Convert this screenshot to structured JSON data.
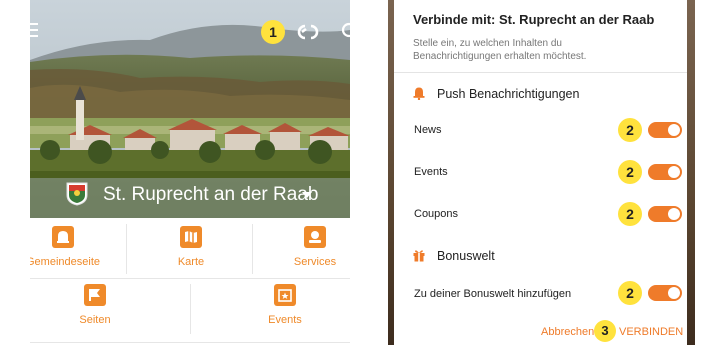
{
  "left_screen": {
    "town_name": "St. Ruprecht an der Raab",
    "annotation_badge": "1",
    "tiles": [
      {
        "label": "Gemeindeseite",
        "icon": "bell-icon"
      },
      {
        "label": "Karte",
        "icon": "map-icon"
      },
      {
        "label": "Services",
        "icon": "services-icon"
      },
      {
        "label": "Seiten",
        "icon": "flag-icon"
      },
      {
        "label": "Events",
        "icon": "calendar-star-icon"
      }
    ],
    "colors": {
      "accent": "#ef8a2a",
      "badge": "#ffe23d"
    }
  },
  "dialog": {
    "title": "Verbinde mit: St. Ruprecht an der Raab",
    "subtitle": "Stelle ein, zu welchen Inhalten du Benachrichtigungen erhalten möchtest.",
    "push_section": {
      "heading": "Push Benachrichtigungen",
      "icon": "bell-icon",
      "items": [
        {
          "label": "News",
          "badge": "2",
          "enabled": true
        },
        {
          "label": "Events",
          "badge": "2",
          "enabled": true
        },
        {
          "label": "Coupons",
          "badge": "2",
          "enabled": true
        }
      ]
    },
    "bonus_section": {
      "heading": "Bonuswelt",
      "icon": "gift-icon",
      "items": [
        {
          "label": "Zu deiner Bonuswelt hinzufügen",
          "badge": "2",
          "enabled": true
        }
      ]
    },
    "cancel_label": "Abbrechen",
    "action_badge": "3",
    "connect_label": "VERBINDEN",
    "colors": {
      "accent": "#ef7b2a"
    }
  }
}
